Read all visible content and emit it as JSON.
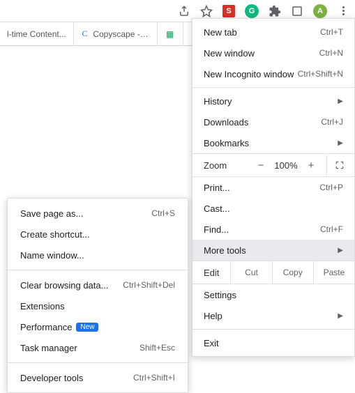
{
  "toolbar": {
    "ext_s": "S",
    "ext_g": "G",
    "ext_a": "A"
  },
  "tabs": [
    {
      "favicon": "",
      "title": "l-time Content..."
    },
    {
      "favicon": "C",
      "title": "Copyscape - Premi..."
    },
    {
      "favicon": "▦",
      "title": ""
    }
  ],
  "menu": {
    "new_tab": "New tab",
    "new_tab_sc": "Ctrl+T",
    "new_window": "New window",
    "new_window_sc": "Ctrl+N",
    "new_incognito": "New Incognito window",
    "new_incognito_sc": "Ctrl+Shift+N",
    "history": "History",
    "downloads": "Downloads",
    "downloads_sc": "Ctrl+J",
    "bookmarks": "Bookmarks",
    "zoom_label": "Zoom",
    "zoom_minus": "−",
    "zoom_val": "100%",
    "zoom_plus": "+",
    "print": "Print...",
    "print_sc": "Ctrl+P",
    "cast": "Cast...",
    "find": "Find...",
    "find_sc": "Ctrl+F",
    "more_tools": "More tools",
    "edit": "Edit",
    "cut": "Cut",
    "copy": "Copy",
    "paste": "Paste",
    "settings": "Settings",
    "help": "Help",
    "exit": "Exit"
  },
  "submenu": {
    "save_page": "Save page as...",
    "save_page_sc": "Ctrl+S",
    "create_shortcut": "Create shortcut...",
    "name_window": "Name window...",
    "clear_data": "Clear browsing data...",
    "clear_data_sc": "Ctrl+Shift+Del",
    "extensions": "Extensions",
    "performance": "Performance",
    "perf_badge": "New",
    "task_manager": "Task manager",
    "task_manager_sc": "Shift+Esc",
    "dev_tools": "Developer tools",
    "dev_tools_sc": "Ctrl+Shift+I"
  }
}
